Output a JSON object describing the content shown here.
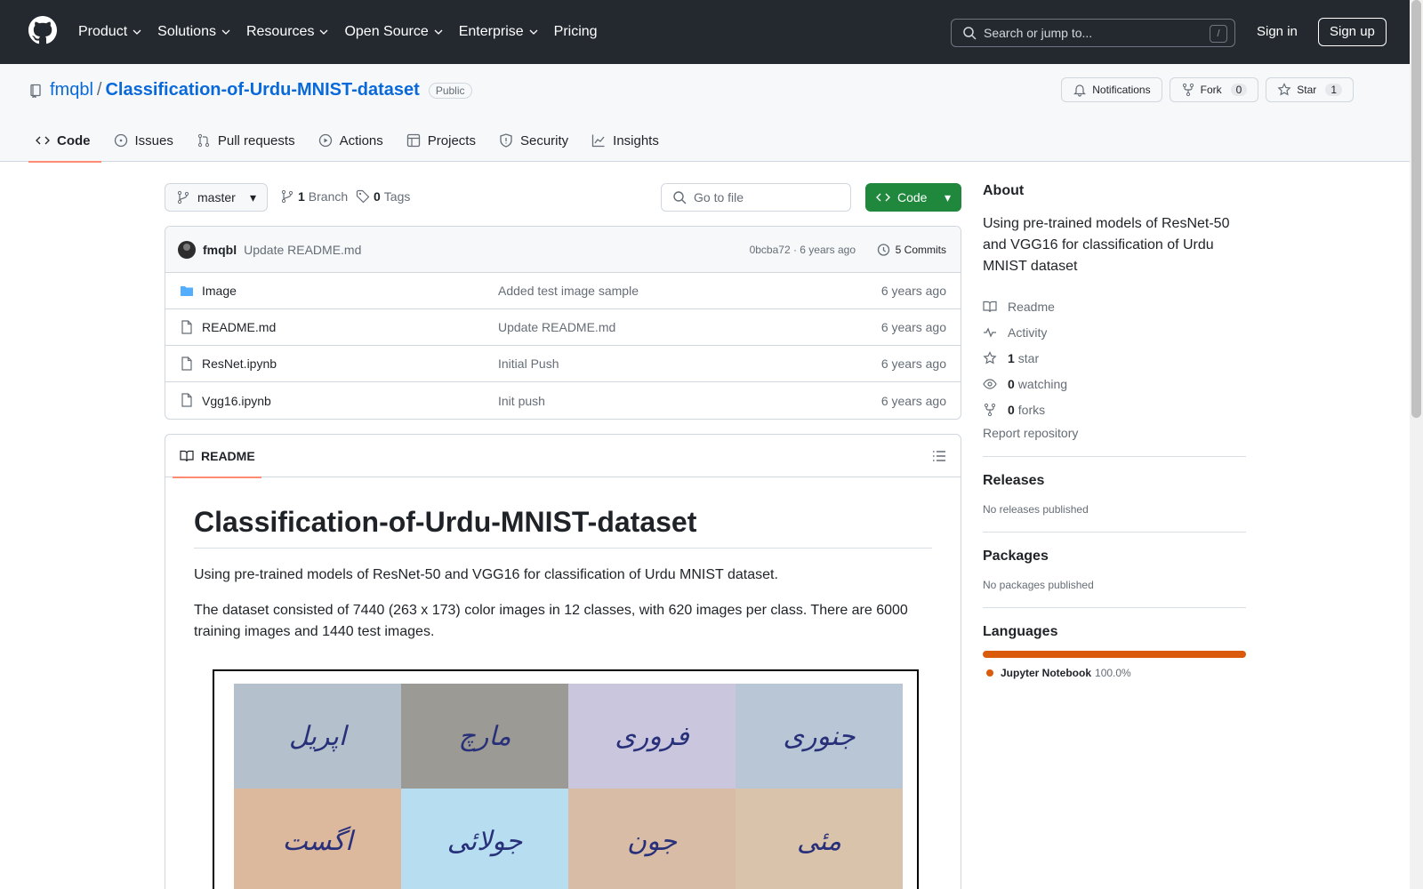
{
  "header": {
    "nav": [
      "Product",
      "Solutions",
      "Resources",
      "Open Source",
      "Enterprise",
      "Pricing"
    ],
    "search_placeholder": "Search or jump to...",
    "search_key": "/",
    "signin": "Sign in",
    "signup": "Sign up"
  },
  "repo": {
    "owner": "fmqbl",
    "sep": "/",
    "name": "Classification-of-Urdu-MNIST-dataset",
    "visibility": "Public",
    "notifications": "Notifications",
    "fork_label": "Fork",
    "fork_count": "0",
    "star_label": "Star",
    "star_count": "1"
  },
  "tabs": [
    "Code",
    "Issues",
    "Pull requests",
    "Actions",
    "Projects",
    "Security",
    "Insights"
  ],
  "toolbar": {
    "branch": "master",
    "branch_count": "1",
    "branch_label": "Branch",
    "tag_count": "0",
    "tag_label": "Tags",
    "goto_placeholder": "Go to file",
    "code_label": "Code"
  },
  "commit": {
    "user": "fmqbl",
    "message": "Update README.md",
    "meta": "0bcba72 · 6 years ago",
    "commits": "5 Commits"
  },
  "files": [
    {
      "name": "Image",
      "type": "folder",
      "message": "Added test image sample",
      "age": "6 years ago"
    },
    {
      "name": "README.md",
      "type": "file",
      "message": "Update README.md",
      "age": "6 years ago"
    },
    {
      "name": "ResNet.ipynb",
      "type": "file",
      "message": "Initial Push",
      "age": "6 years ago"
    },
    {
      "name": "Vgg16.ipynb",
      "type": "file",
      "message": "Init push",
      "age": "6 years ago"
    }
  ],
  "readme": {
    "tab": "README",
    "title": "Classification-of-Urdu-MNIST-dataset",
    "p1": "Using pre-trained models of ResNet-50 and VGG16 for classification of Urdu MNIST dataset.",
    "p2": "The dataset consisted of 7440 (263 x 173) color images in 12 classes, with 620 images per class. There are 6000 training images and 1440 test images.",
    "samples": [
      {
        "text": "اپریل",
        "bg": "#b4c0cc"
      },
      {
        "text": "مارچ",
        "bg": "#9c9a94"
      },
      {
        "text": "فروری",
        "bg": "#c9c6de"
      },
      {
        "text": "جنوری",
        "bg": "#b9c6d6"
      },
      {
        "text": "اگست",
        "bg": "#dcb89c"
      },
      {
        "text": "جولائی",
        "bg": "#b6def0"
      },
      {
        "text": "جون",
        "bg": "#d8bca6"
      },
      {
        "text": "مئی",
        "bg": "#d9c3ab"
      }
    ]
  },
  "about": {
    "title": "About",
    "description": "Using pre-trained models of ResNet-50 and VGG16 for classification of Urdu MNIST dataset",
    "readme": "Readme",
    "activity": "Activity",
    "stars_count": "1",
    "stars_label": "star",
    "watching_count": "0",
    "watching_label": "watching",
    "forks_count": "0",
    "forks_label": "forks",
    "report": "Report repository"
  },
  "releases": {
    "title": "Releases",
    "empty": "No releases published"
  },
  "packages": {
    "title": "Packages",
    "empty": "No packages published"
  },
  "languages": {
    "title": "Languages",
    "items": [
      {
        "name": "Jupyter Notebook",
        "pct": "100.0%",
        "color": "#da5b0b"
      }
    ]
  },
  "colors": {
    "header_bg": "#24292f",
    "accent": "#0969da",
    "primary_button": "#1f883d",
    "active_tab": "#fd8c73"
  }
}
